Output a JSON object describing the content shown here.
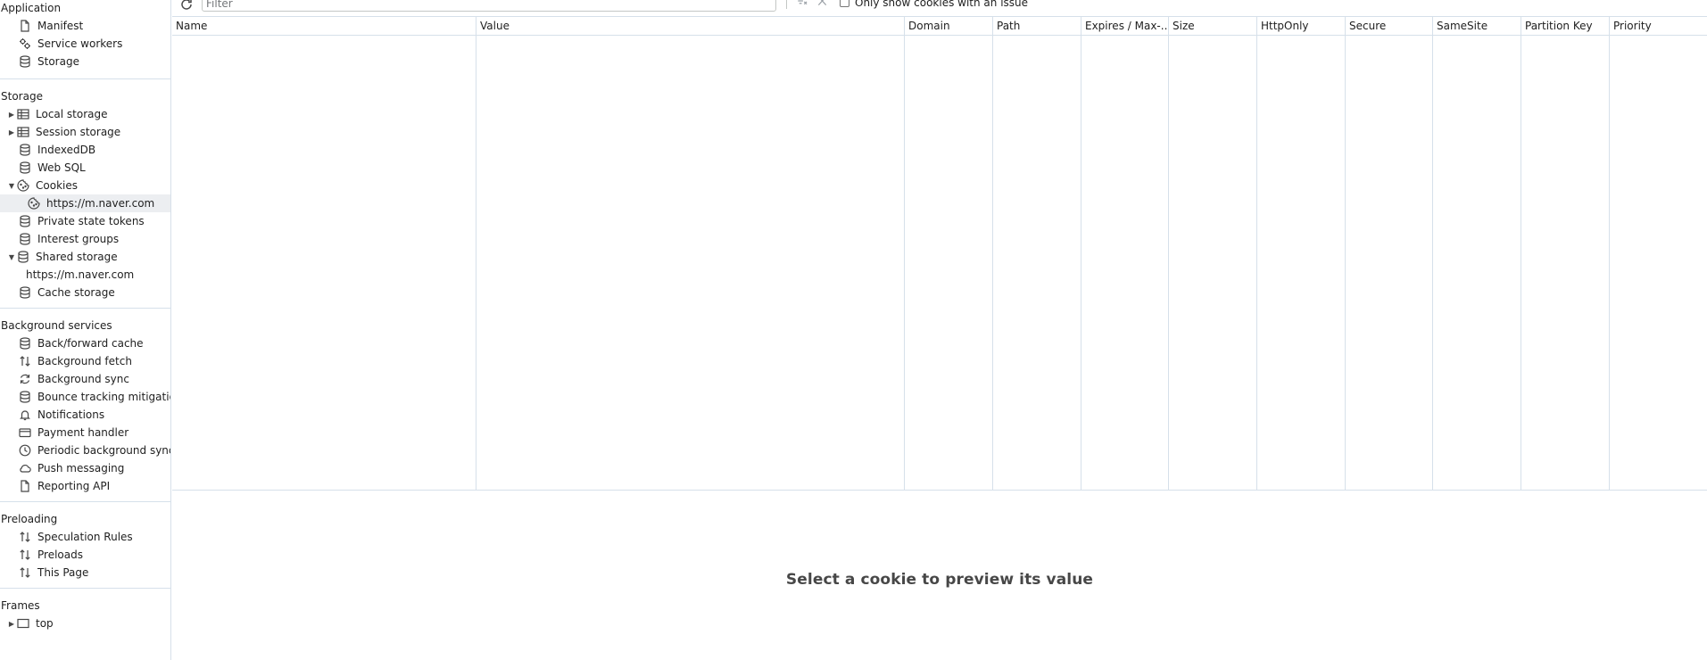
{
  "sidebar": {
    "application": {
      "title": "Application",
      "items": [
        {
          "label": "Manifest"
        },
        {
          "label": "Service workers"
        },
        {
          "label": "Storage"
        }
      ]
    },
    "storage": {
      "title": "Storage",
      "items": [
        {
          "label": "Local storage"
        },
        {
          "label": "Session storage"
        },
        {
          "label": "IndexedDB"
        },
        {
          "label": "Web SQL"
        },
        {
          "label": "Cookies"
        },
        {
          "label": "https://m.naver.com"
        },
        {
          "label": "Private state tokens"
        },
        {
          "label": "Interest groups"
        },
        {
          "label": "Shared storage"
        },
        {
          "label": "https://m.naver.com"
        },
        {
          "label": "Cache storage"
        }
      ]
    },
    "background": {
      "title": "Background services",
      "items": [
        {
          "label": "Back/forward cache"
        },
        {
          "label": "Background fetch"
        },
        {
          "label": "Background sync"
        },
        {
          "label": "Bounce tracking mitigations"
        },
        {
          "label": "Notifications"
        },
        {
          "label": "Payment handler"
        },
        {
          "label": "Periodic background sync"
        },
        {
          "label": "Push messaging"
        },
        {
          "label": "Reporting API"
        }
      ]
    },
    "preloading": {
      "title": "Preloading",
      "items": [
        {
          "label": "Speculation Rules"
        },
        {
          "label": "Preloads"
        },
        {
          "label": "This Page"
        }
      ]
    },
    "frames": {
      "title": "Frames",
      "items": [
        {
          "label": "top"
        }
      ]
    }
  },
  "toolbar": {
    "filter_placeholder": "Filter",
    "only_issues_label": "Only show cookies with an issue"
  },
  "table": {
    "columns": [
      "Name",
      "Value",
      "Domain",
      "Path",
      "Expires / Max-...",
      "Size",
      "HttpOnly",
      "Secure",
      "SameSite",
      "Partition Key",
      "Priority"
    ],
    "rows": []
  },
  "preview": {
    "empty_text": "Select a cookie to preview its value"
  }
}
